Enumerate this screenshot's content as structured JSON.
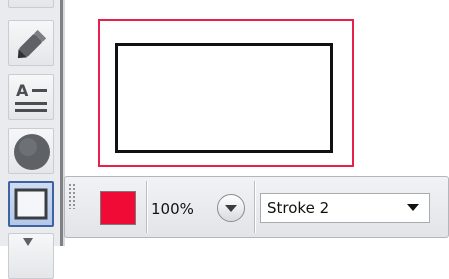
{
  "toolbar": {
    "tools": [
      "pen-tool",
      "text-tool",
      "ellipse-tool",
      "rectangle-tool"
    ],
    "selected_tool": "rectangle-tool"
  },
  "properties": {
    "color": "#f00a36",
    "opacity": "100%",
    "stroke": "Stroke 2"
  },
  "colors": {
    "selection": "#e8214c",
    "shape_stroke": "#111111"
  }
}
